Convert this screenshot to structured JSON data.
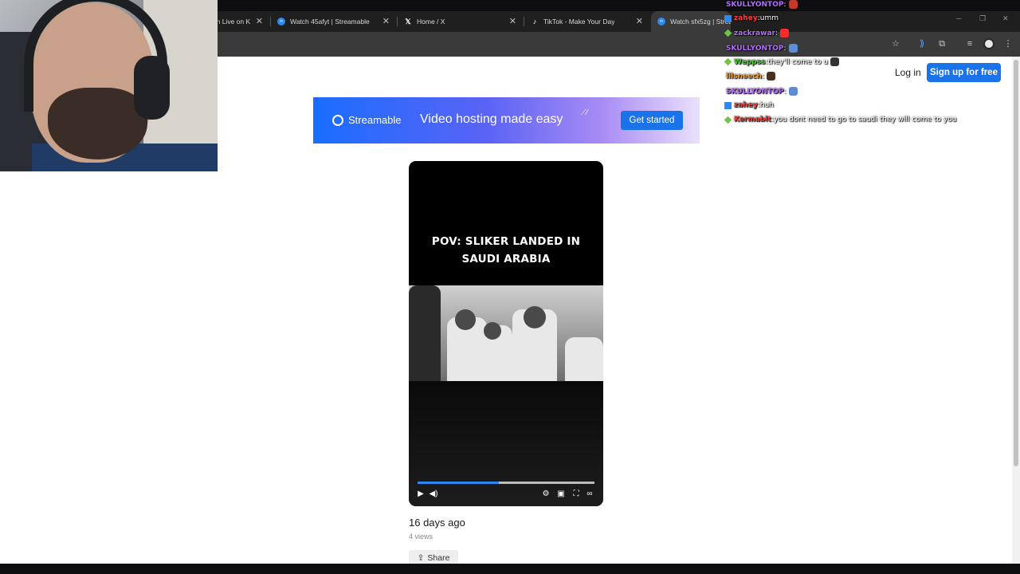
{
  "browser": {
    "tabs": [
      {
        "title": "tch Live on K",
        "icon": "kick-icon"
      },
      {
        "title": "Watch 45afyt | Streamable",
        "icon": "streamable-icon"
      },
      {
        "title": "Home / X",
        "icon": "x-icon"
      },
      {
        "title": "TikTok - Make Your Day",
        "icon": "tiktok-icon"
      },
      {
        "title": "Watch sfx5zg | Streamable",
        "icon": "streamable-icon",
        "active": true
      }
    ]
  },
  "header": {
    "login_label": "Log in",
    "signup_label": "Sign up for free"
  },
  "banner": {
    "logo_text": "Streamable",
    "tagline": "Video hosting made easy",
    "cta_label": "Get started"
  },
  "video": {
    "caption": "POV: SLIKER LANDED IN SAUDI ARABIA",
    "progress_fraction": 0.46
  },
  "meta": {
    "upload_age": "16 days ago",
    "views": "4 views",
    "share_label": "Share"
  },
  "chat": [
    {
      "user": "SKULLYONTOP",
      "message": "",
      "user_color": "#b36bff",
      "badge": "",
      "emote": "#c0392b"
    },
    {
      "user": "zahey",
      "message": "umm",
      "user_color": "#ff3b3b",
      "badge": "blue"
    },
    {
      "user": "zackrawar",
      "message": "",
      "user_color": "#b36bff",
      "badge": "green",
      "emote": "#ff2a2a"
    },
    {
      "user": "SKULLYONTOP",
      "message": "",
      "user_color": "#b36bff",
      "badge": "",
      "emote": "#5a8fd8"
    },
    {
      "user": "Weppss",
      "message": "they'll come to u",
      "user_color": "#4cd137",
      "badge": "green",
      "emote": "#333333"
    },
    {
      "user": "lilsneech",
      "message": "",
      "user_color": "#ff9f1a",
      "badge": "",
      "emote": "#4a3020"
    },
    {
      "user": "SKULLYONTOP",
      "message": "",
      "user_color": "#b36bff",
      "badge": "",
      "emote": "#5a8fd8"
    },
    {
      "user": "zahey",
      "message": "huh",
      "user_color": "#ff3b3b",
      "badge": "blue"
    },
    {
      "user": "Kermablt",
      "message": "you dont need to go to saudi they will come to you",
      "user_color": "#ff3b3b",
      "badge": "green"
    }
  ]
}
